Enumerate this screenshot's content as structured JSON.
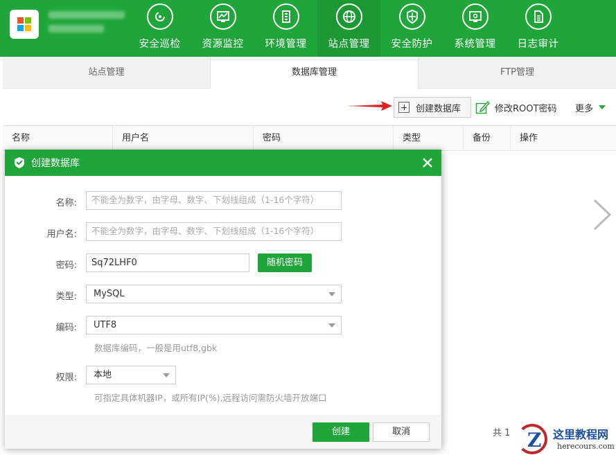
{
  "header": {
    "nav": [
      {
        "label": "安全巡检",
        "icon": "scan-icon"
      },
      {
        "label": "资源监控",
        "icon": "monitor-chart-icon"
      },
      {
        "label": "环境管理",
        "icon": "building-icon"
      },
      {
        "label": "站点管理",
        "icon": "globe-icon",
        "active": true
      },
      {
        "label": "安全防护",
        "icon": "shield-icon"
      },
      {
        "label": "系统管理",
        "icon": "settings-monitor-icon"
      },
      {
        "label": "日志审计",
        "icon": "document-icon"
      }
    ]
  },
  "tabs": [
    {
      "label": "站点管理"
    },
    {
      "label": "数据库管理",
      "active": true
    },
    {
      "label": "FTP管理"
    }
  ],
  "toolbar": {
    "create_db": "创建数据库",
    "modify_root": "修改ROOT密码",
    "more": "更多"
  },
  "table": {
    "columns": [
      "名称",
      "用户名",
      "密码",
      "类型",
      "备份",
      "操作"
    ]
  },
  "pager": {
    "text": "共 1"
  },
  "modal": {
    "title": "创建数据库",
    "name_label": "名称:",
    "name_placeholder": "不能全为数字，由字母、数字、下划线组成（1-16个字符）",
    "user_label": "用户名:",
    "user_placeholder": "不能全为数字，由字母、数字、下划线组成（1-16个字符）",
    "password_label": "密码:",
    "password_value": "Sq72LHF0",
    "random_password": "随机密码",
    "type_label": "类型:",
    "type_value": "MySQL",
    "encoding_label": "编码:",
    "encoding_value": "UTF8",
    "encoding_hint": "数据库编码，一般是用utf8,gbk",
    "access_label": "权限:",
    "access_value": "本地",
    "access_hint": "可指定具体机器IP，或所有IP(%),远程访问需防火墙开放端口",
    "ok": "创建",
    "cancel": "取消"
  },
  "watermark": {
    "title": "这里教程网",
    "url": "herecours.com",
    "letter": "Z"
  },
  "colors": {
    "brand": "#20a53a",
    "arrow": "#e02020"
  }
}
